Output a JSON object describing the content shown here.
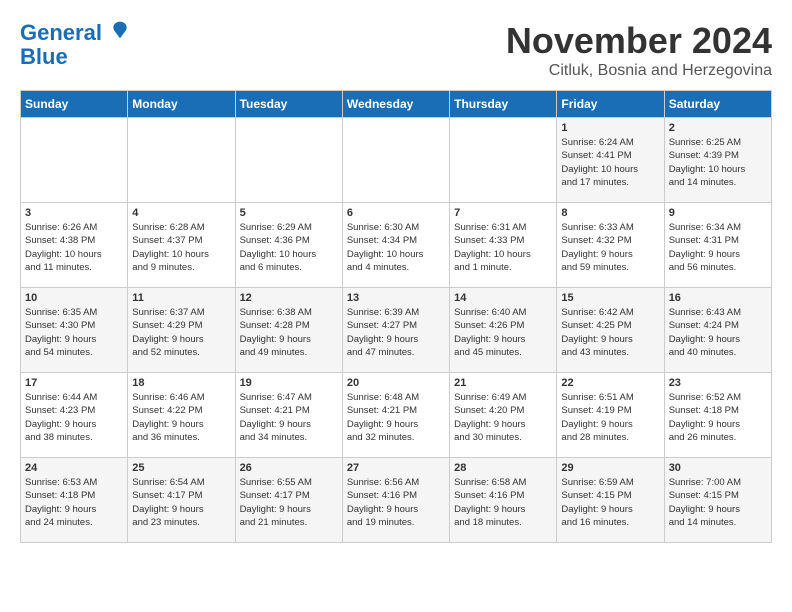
{
  "logo": {
    "line1": "General",
    "line2": "Blue"
  },
  "title": "November 2024",
  "subtitle": "Citluk, Bosnia and Herzegovina",
  "headers": [
    "Sunday",
    "Monday",
    "Tuesday",
    "Wednesday",
    "Thursday",
    "Friday",
    "Saturday"
  ],
  "weeks": [
    [
      {
        "day": "",
        "info": ""
      },
      {
        "day": "",
        "info": ""
      },
      {
        "day": "",
        "info": ""
      },
      {
        "day": "",
        "info": ""
      },
      {
        "day": "",
        "info": ""
      },
      {
        "day": "1",
        "info": "Sunrise: 6:24 AM\nSunset: 4:41 PM\nDaylight: 10 hours\nand 17 minutes."
      },
      {
        "day": "2",
        "info": "Sunrise: 6:25 AM\nSunset: 4:39 PM\nDaylight: 10 hours\nand 14 minutes."
      }
    ],
    [
      {
        "day": "3",
        "info": "Sunrise: 6:26 AM\nSunset: 4:38 PM\nDaylight: 10 hours\nand 11 minutes."
      },
      {
        "day": "4",
        "info": "Sunrise: 6:28 AM\nSunset: 4:37 PM\nDaylight: 10 hours\nand 9 minutes."
      },
      {
        "day": "5",
        "info": "Sunrise: 6:29 AM\nSunset: 4:36 PM\nDaylight: 10 hours\nand 6 minutes."
      },
      {
        "day": "6",
        "info": "Sunrise: 6:30 AM\nSunset: 4:34 PM\nDaylight: 10 hours\nand 4 minutes."
      },
      {
        "day": "7",
        "info": "Sunrise: 6:31 AM\nSunset: 4:33 PM\nDaylight: 10 hours\nand 1 minute."
      },
      {
        "day": "8",
        "info": "Sunrise: 6:33 AM\nSunset: 4:32 PM\nDaylight: 9 hours\nand 59 minutes."
      },
      {
        "day": "9",
        "info": "Sunrise: 6:34 AM\nSunset: 4:31 PM\nDaylight: 9 hours\nand 56 minutes."
      }
    ],
    [
      {
        "day": "10",
        "info": "Sunrise: 6:35 AM\nSunset: 4:30 PM\nDaylight: 9 hours\nand 54 minutes."
      },
      {
        "day": "11",
        "info": "Sunrise: 6:37 AM\nSunset: 4:29 PM\nDaylight: 9 hours\nand 52 minutes."
      },
      {
        "day": "12",
        "info": "Sunrise: 6:38 AM\nSunset: 4:28 PM\nDaylight: 9 hours\nand 49 minutes."
      },
      {
        "day": "13",
        "info": "Sunrise: 6:39 AM\nSunset: 4:27 PM\nDaylight: 9 hours\nand 47 minutes."
      },
      {
        "day": "14",
        "info": "Sunrise: 6:40 AM\nSunset: 4:26 PM\nDaylight: 9 hours\nand 45 minutes."
      },
      {
        "day": "15",
        "info": "Sunrise: 6:42 AM\nSunset: 4:25 PM\nDaylight: 9 hours\nand 43 minutes."
      },
      {
        "day": "16",
        "info": "Sunrise: 6:43 AM\nSunset: 4:24 PM\nDaylight: 9 hours\nand 40 minutes."
      }
    ],
    [
      {
        "day": "17",
        "info": "Sunrise: 6:44 AM\nSunset: 4:23 PM\nDaylight: 9 hours\nand 38 minutes."
      },
      {
        "day": "18",
        "info": "Sunrise: 6:46 AM\nSunset: 4:22 PM\nDaylight: 9 hours\nand 36 minutes."
      },
      {
        "day": "19",
        "info": "Sunrise: 6:47 AM\nSunset: 4:21 PM\nDaylight: 9 hours\nand 34 minutes."
      },
      {
        "day": "20",
        "info": "Sunrise: 6:48 AM\nSunset: 4:21 PM\nDaylight: 9 hours\nand 32 minutes."
      },
      {
        "day": "21",
        "info": "Sunrise: 6:49 AM\nSunset: 4:20 PM\nDaylight: 9 hours\nand 30 minutes."
      },
      {
        "day": "22",
        "info": "Sunrise: 6:51 AM\nSunset: 4:19 PM\nDaylight: 9 hours\nand 28 minutes."
      },
      {
        "day": "23",
        "info": "Sunrise: 6:52 AM\nSunset: 4:18 PM\nDaylight: 9 hours\nand 26 minutes."
      }
    ],
    [
      {
        "day": "24",
        "info": "Sunrise: 6:53 AM\nSunset: 4:18 PM\nDaylight: 9 hours\nand 24 minutes."
      },
      {
        "day": "25",
        "info": "Sunrise: 6:54 AM\nSunset: 4:17 PM\nDaylight: 9 hours\nand 23 minutes."
      },
      {
        "day": "26",
        "info": "Sunrise: 6:55 AM\nSunset: 4:17 PM\nDaylight: 9 hours\nand 21 minutes."
      },
      {
        "day": "27",
        "info": "Sunrise: 6:56 AM\nSunset: 4:16 PM\nDaylight: 9 hours\nand 19 minutes."
      },
      {
        "day": "28",
        "info": "Sunrise: 6:58 AM\nSunset: 4:16 PM\nDaylight: 9 hours\nand 18 minutes."
      },
      {
        "day": "29",
        "info": "Sunrise: 6:59 AM\nSunset: 4:15 PM\nDaylight: 9 hours\nand 16 minutes."
      },
      {
        "day": "30",
        "info": "Sunrise: 7:00 AM\nSunset: 4:15 PM\nDaylight: 9 hours\nand 14 minutes."
      }
    ]
  ]
}
